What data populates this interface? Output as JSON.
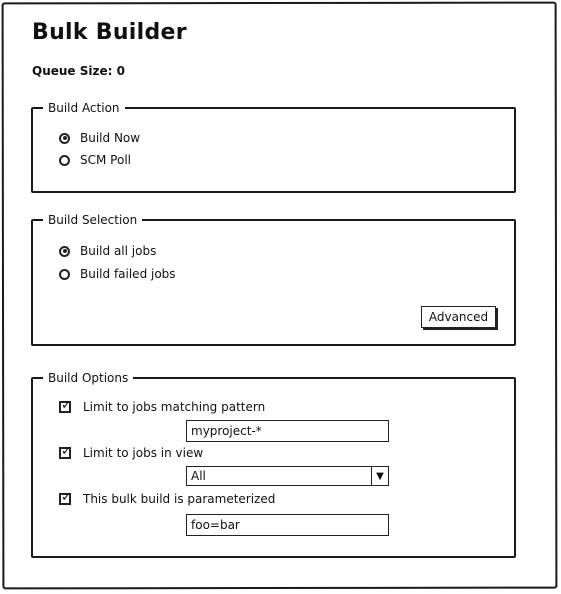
{
  "page": {
    "title": "Bulk Builder"
  },
  "queue": {
    "label": "Queue Size:",
    "value": "0"
  },
  "build_action": {
    "legend": "Build Action",
    "options": [
      {
        "label": "Build Now",
        "checked": true
      },
      {
        "label": "SCM Poll",
        "checked": false
      }
    ]
  },
  "build_selection": {
    "legend": "Build Selection",
    "options": [
      {
        "label": "Build all jobs",
        "checked": true
      },
      {
        "label": "Build failed jobs",
        "checked": false
      }
    ],
    "advanced_label": "Advanced"
  },
  "build_options": {
    "legend": "Build Options",
    "pattern": {
      "label": "Limit to jobs matching pattern",
      "checked": true,
      "value": "myproject-*"
    },
    "view": {
      "label": "Limit to jobs in view",
      "checked": true,
      "selected": "All",
      "arrow_icon": "triangle-down-icon"
    },
    "params": {
      "label": "This bulk build is parameterized",
      "checked": true,
      "value": "foo=bar"
    }
  }
}
